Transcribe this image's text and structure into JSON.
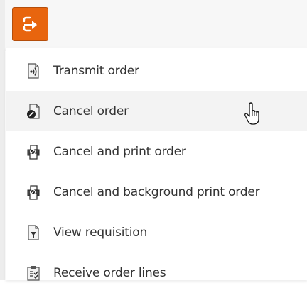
{
  "button": {
    "icon": "order-actions-icon",
    "color": "#e8650e"
  },
  "menu": {
    "items": [
      {
        "label": "Transmit order",
        "icon": "transmit-icon"
      },
      {
        "label": "Cancel order",
        "icon": "cancel-document-icon"
      },
      {
        "label": "Cancel and print order",
        "icon": "printer-icon"
      },
      {
        "label": "Cancel and background print order",
        "icon": "printer-icon"
      },
      {
        "label": "View requisition",
        "icon": "view-document-icon"
      },
      {
        "label": "Receive order lines",
        "icon": "receive-clipboard-icon"
      }
    ]
  }
}
